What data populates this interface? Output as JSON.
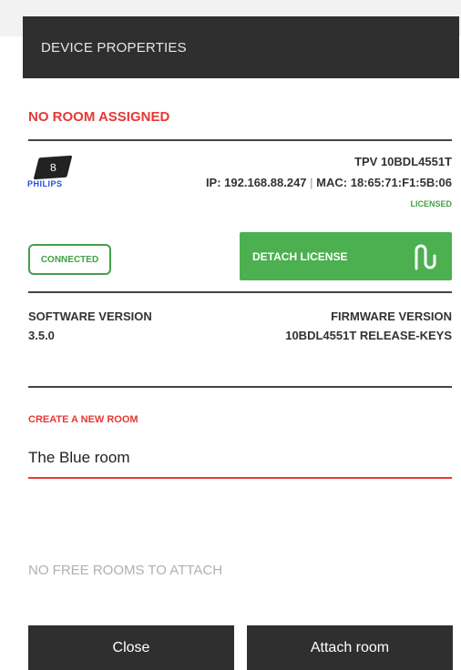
{
  "dialog": {
    "title": "DEVICE PROPERTIES"
  },
  "room_status": "NO ROOM ASSIGNED",
  "device": {
    "logo_number": "8",
    "brand": "PHILIPS",
    "model": "TPV 10BDL4551T",
    "ip_label": "IP: 192.168.88.247",
    "separator": "|",
    "mac_label": "MAC: 18:65:71:F1:5B:06",
    "license_status": "LICENSED",
    "connection_status": "CONNECTED",
    "detach_license_label": "DETACH LICENSE"
  },
  "versions": {
    "software_label": "SOFTWARE VERSION",
    "software_value": "3.5.0",
    "firmware_label": "FIRMWARE VERSION",
    "firmware_value": "10BDL4551T RELEASE-KEYS"
  },
  "create_room": {
    "label": "CREATE A NEW ROOM",
    "value": "The Blue room"
  },
  "no_free_rooms": "NO FREE ROOMS TO ATTACH",
  "buttons": {
    "close": "Close",
    "attach": "Attach room"
  },
  "colors": {
    "accent_red": "#e53935",
    "accent_green": "#4caf50",
    "header_bg": "#2f2f2f"
  }
}
